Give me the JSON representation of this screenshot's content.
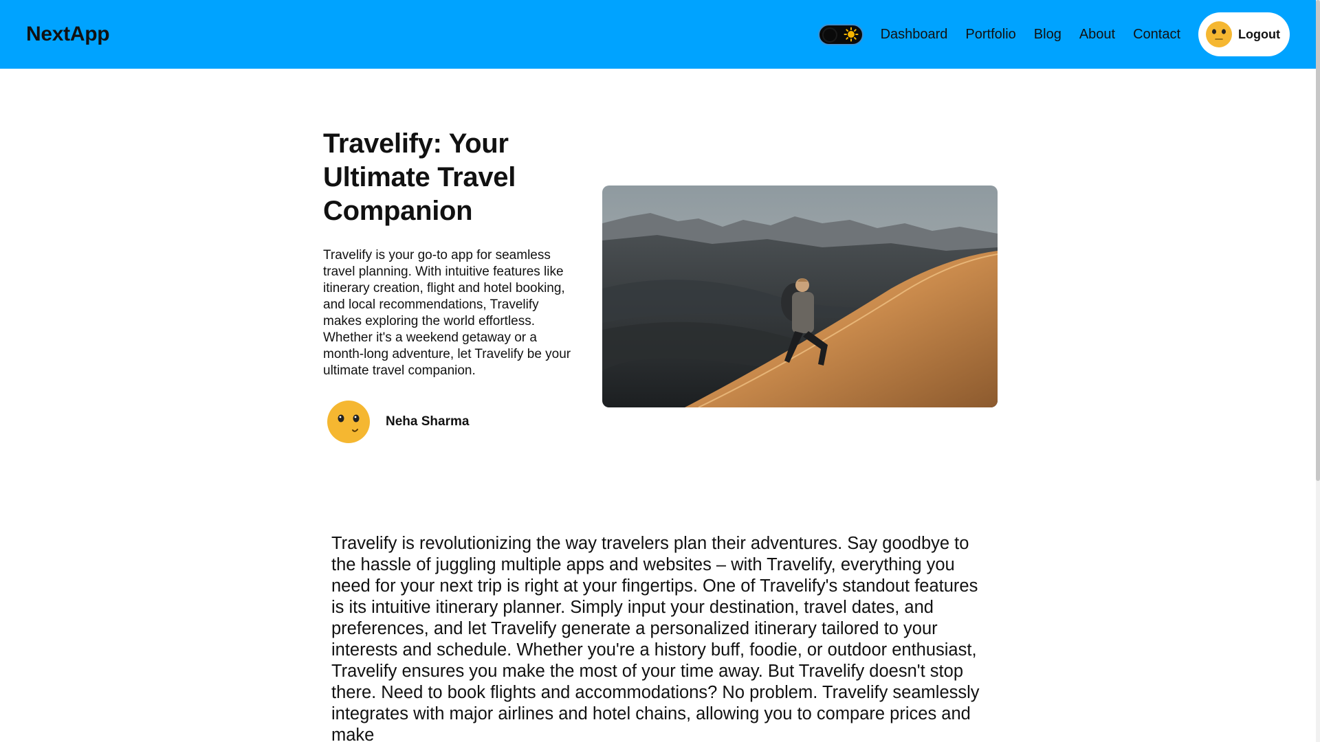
{
  "navbar": {
    "brand": "NextApp",
    "links": [
      "Dashboard",
      "Portfolio",
      "Blog",
      "About",
      "Contact"
    ],
    "logout_label": "Logout",
    "background_color": "#00a3ff"
  },
  "icons": {
    "theme_toggle": "moon-sun-toggle-icon",
    "sun": "sun-icon",
    "avatar": "smiley-face-icon"
  },
  "post": {
    "title": "Travelify: Your Ultimate Travel Companion",
    "summary": "Travelify is your go-to app for seamless travel planning. With intuitive features like itinerary creation, flight and hotel booking, and local recommendations, Travelify makes exploring the world effortless. Whether it's a weekend getaway or a month-long adventure, let Travelify be your ultimate travel companion.",
    "author": "Neha Sharma",
    "body": "Travelify is revolutionizing the way travelers plan their adventures. Say goodbye to the hassle of juggling multiple apps and websites – with Travelify, everything you need for your next trip is right at your fingertips. One of Travelify's standout features is its intuitive itinerary planner. Simply input your destination, travel dates, and preferences, and let Travelify generate a personalized itinerary tailored to your interests and schedule. Whether you're a history buff, foodie, or outdoor enthusiast, Travelify ensures you make the most of your time away. But Travelify doesn't stop there. Need to book flights and accommodations? No problem. Travelify seamlessly integrates with major airlines and hotel chains, allowing you to compare prices and make"
  }
}
